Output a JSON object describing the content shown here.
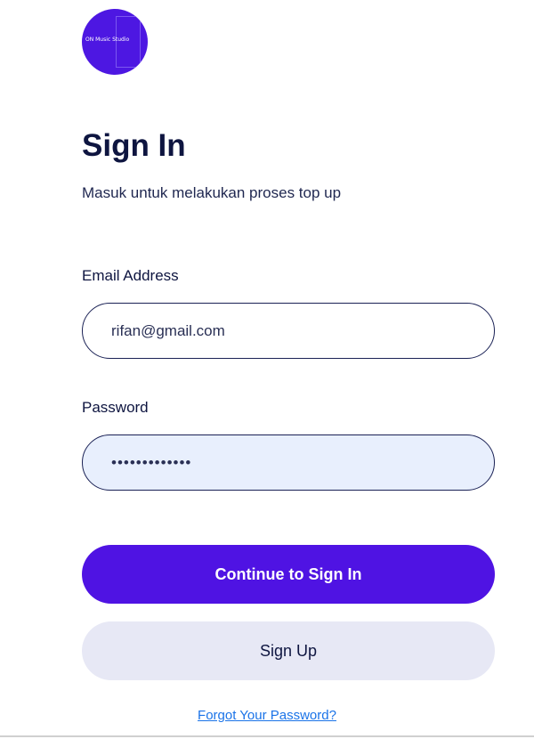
{
  "logo": {
    "text": "ON Music Studio",
    "color": "#4d17e2"
  },
  "header": {
    "title": "Sign In",
    "subtitle": "Masuk untuk melakukan proses top up"
  },
  "form": {
    "email_label": "Email Address",
    "email_value": "rifan@gmail.com",
    "password_label": "Password",
    "password_value": "•••••••••••••"
  },
  "actions": {
    "signin_label": "Continue to Sign In",
    "signup_label": "Sign Up",
    "forgot_label": "Forgot Your Password?"
  },
  "colors": {
    "primary": "#4f13e3",
    "secondary_bg": "#e7e8f5",
    "heading": "#0e1540",
    "link": "#1a73e8"
  }
}
